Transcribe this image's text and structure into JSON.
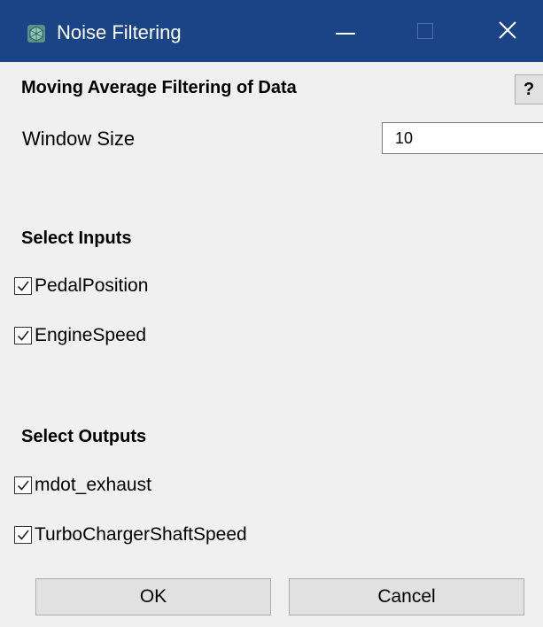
{
  "window": {
    "title": "Noise Filtering",
    "icon": "app-icon",
    "titlebar_color": "#1b4487"
  },
  "moving_average": {
    "heading": "Moving Average Filtering of Data",
    "help_label": "?",
    "window_size_label": "Window Size",
    "window_size_value": "10"
  },
  "inputs": {
    "heading": "Select Inputs",
    "items": [
      {
        "label": "PedalPosition",
        "checked": true
      },
      {
        "label": "EngineSpeed",
        "checked": true
      }
    ]
  },
  "outputs": {
    "heading": "Select Outputs",
    "items": [
      {
        "label": "mdot_exhaust",
        "checked": true
      },
      {
        "label": "TurboChargerShaftSpeed",
        "checked": true
      }
    ]
  },
  "buttons": {
    "ok": "OK",
    "cancel": "Cancel"
  }
}
